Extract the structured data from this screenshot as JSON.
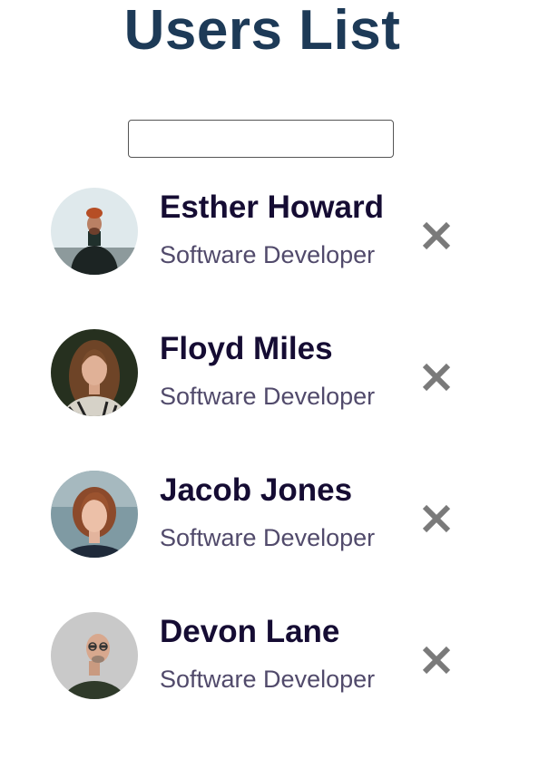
{
  "page": {
    "title": "Users List"
  },
  "search": {
    "value": "",
    "placeholder": ""
  },
  "users": [
    {
      "name": "Esther Howard",
      "role": "Software Developer",
      "avatar": "avatar-photo-man-orange-beanie"
    },
    {
      "name": "Floyd Miles",
      "role": "Software Developer",
      "avatar": "avatar-photo-woman-long-hair"
    },
    {
      "name": "Jacob Jones",
      "role": "Software Developer",
      "avatar": "avatar-photo-woman-bob-hair"
    },
    {
      "name": "Devon Lane",
      "role": "Software Developer",
      "avatar": "avatar-photo-man-glasses"
    }
  ],
  "icons": {
    "remove": "close-icon"
  },
  "colors": {
    "title": "#1d3a57",
    "name": "#150c33",
    "role": "#514a6b",
    "remove_icon": "#7a7a7a"
  }
}
